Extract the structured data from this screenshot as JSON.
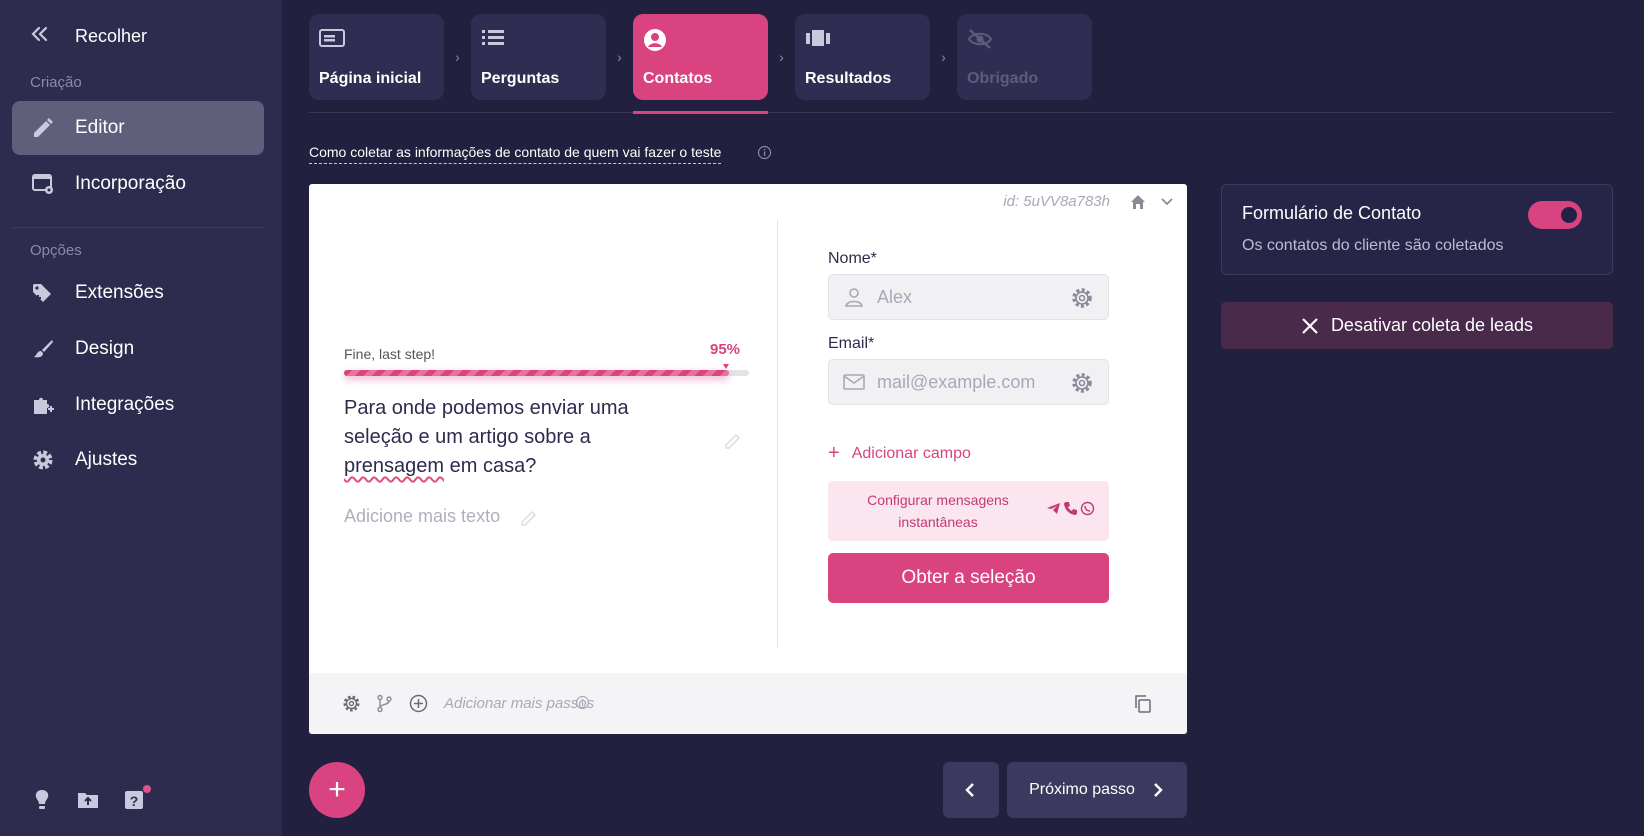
{
  "sidebar": {
    "collapse_label": "Recolher",
    "section_creation": "Criação",
    "section_options": "Opções",
    "items": [
      {
        "label": "Editor",
        "icon": "pencil-icon",
        "active": true
      },
      {
        "label": "Incorporação",
        "icon": "embed-gear-icon"
      },
      {
        "label": "Extensões",
        "icon": "tag-plus-icon"
      },
      {
        "label": "Design",
        "icon": "brush-icon"
      },
      {
        "label": "Integrações",
        "icon": "puzzle-plus-icon"
      },
      {
        "label": "Ajustes",
        "icon": "gear-icon"
      }
    ],
    "bottom_icons": [
      "lightbulb-icon",
      "folder-upload-icon",
      "help-icon"
    ]
  },
  "steps": [
    {
      "label": "Página inicial",
      "icon": "card-icon"
    },
    {
      "label": "Perguntas",
      "icon": "list-icon"
    },
    {
      "label": "Contatos",
      "icon": "user-circle-icon",
      "active": true
    },
    {
      "label": "Resultados",
      "icon": "columns-icon"
    },
    {
      "label": "Obrigado",
      "icon": "eye-off-icon",
      "disabled": true
    }
  ],
  "hint": "Como coletar as informações de contato de quem vai fazer o teste",
  "card": {
    "id": "id: 5uVV8a783h",
    "progress_label": "Fine, last step!",
    "progress_pct": "95%",
    "progress_value": 0.95,
    "question_line1": "Para onde podemos enviar uma seleção e um artigo sobre a",
    "question_line2": "prensagem",
    "question_line3": " em casa?",
    "more_text": "Adicione mais texto",
    "name_label": "Nome*",
    "name_placeholder": "Alex",
    "email_label": "Email*",
    "email_placeholder": "mail@example.com",
    "add_field": "Adicionar campo",
    "messengers": "Configurar mensagens instantâneas",
    "cta": "Obter a seleção",
    "footer_text": "Adicionar mais passos"
  },
  "contact_panel": {
    "title": "Formulário de Contato",
    "subtitle": "Os contatos do cliente são coletados",
    "toggle_on": true
  },
  "deactivate": "Desativar coleta de leads",
  "fab": "+",
  "next": "Próximo passo",
  "colors": {
    "accent": "#d9437f",
    "bg": "#21203f",
    "sidebar": "#2d2c4e"
  }
}
